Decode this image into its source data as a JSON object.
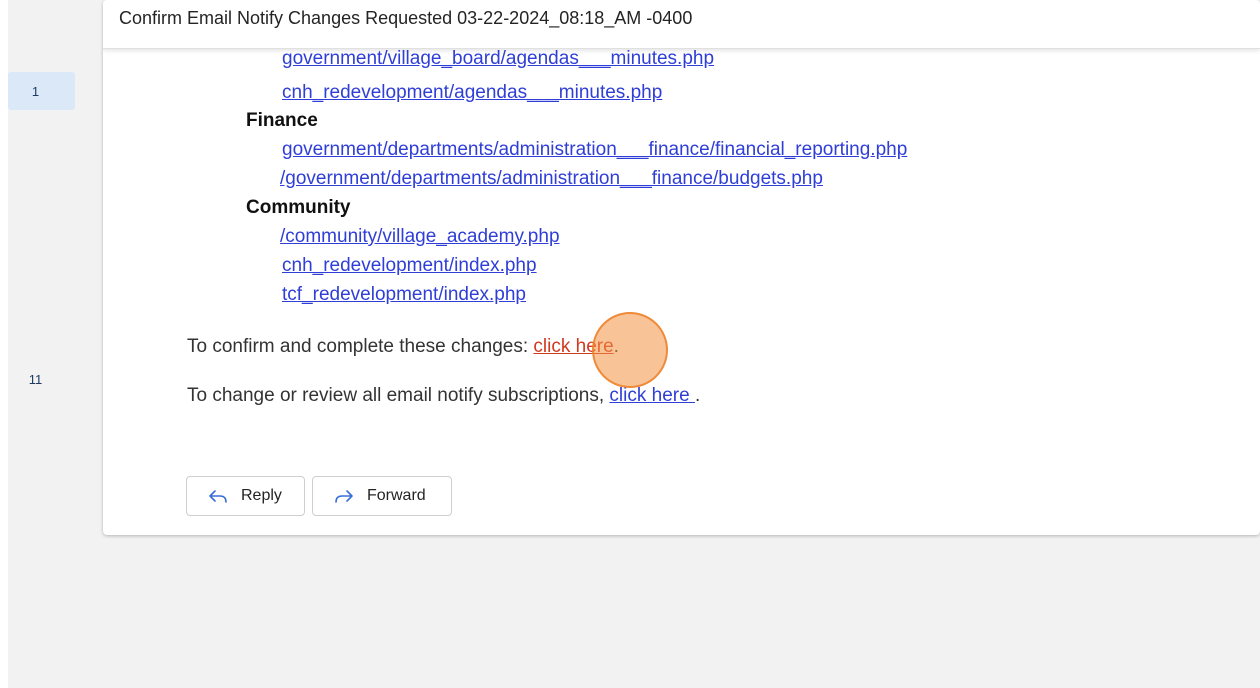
{
  "message": {
    "subject": "Confirm Email Notify Changes Requested 03-22-2024_08:18_AM -0400"
  },
  "rail": {
    "items": [
      {
        "label": "1",
        "active": true
      },
      {
        "label": "11",
        "active": false
      }
    ]
  },
  "body": {
    "partial_link": "government/village_board/agendas___minutes.php",
    "links_top": [
      "cnh_redevelopment/agendas___minutes.php"
    ],
    "sections": [
      {
        "heading": "Finance",
        "links": [
          "government/departments/administration___finance/financial_reporting.php",
          "/government/departments/administration___finance/budgets.php"
        ]
      },
      {
        "heading": "Community",
        "links": [
          "/community/village_academy.php",
          "cnh_redevelopment/index.php",
          "tcf_redevelopment/index.php"
        ]
      }
    ],
    "confirm": {
      "text": "To confirm and complete these changes: ",
      "link": "click here",
      "suffix": "."
    },
    "review": {
      "text": "To change or review all email notify subscriptions, ",
      "link": "click here ",
      "suffix": "."
    }
  },
  "actions": {
    "reply_label": "Reply",
    "forward_label": "Forward",
    "reply_icon": "reply-arrow-icon",
    "forward_icon": "forward-arrow-icon"
  },
  "colors": {
    "link": "#2f3ed6",
    "highlight_link": "#d3391f",
    "cursor_ring": "#f49244"
  }
}
